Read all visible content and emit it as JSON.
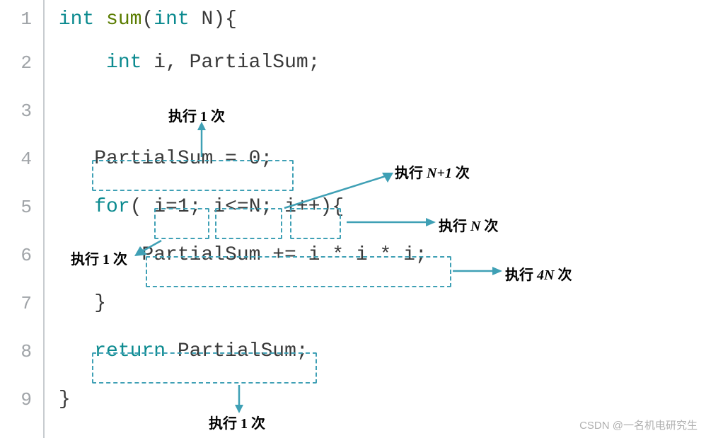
{
  "lines": {
    "l1_nums": [
      "1",
      "2",
      "3",
      "4",
      "5",
      "6",
      "7",
      "8",
      "9"
    ],
    "l1": {
      "kw1": "int",
      "fn": "sum",
      "kw2": "int",
      "arg": "N",
      "tail": "){"
    },
    "l2": {
      "kw": "int",
      "rest": " i, PartialSum;"
    },
    "l4": {
      "stmt": "PartialSum = 0;"
    },
    "l5": {
      "kw": "for",
      "p_init": "i=1;",
      "p_cond": "i<=N;",
      "p_inc": "i++",
      "tail": "){"
    },
    "l6": {
      "stmt": "PartialSum += i * i * i;"
    },
    "l7": {
      "brace": "}"
    },
    "l8": {
      "kw": "return",
      "rest": " PartialSum;"
    },
    "l9": {
      "brace": "}"
    }
  },
  "annotations": {
    "exec1a": "执行 1 次",
    "execNp1": {
      "pre": "执行 ",
      "it": "N+1",
      "post": " 次"
    },
    "execN": {
      "pre": "执行 ",
      "it": "N",
      "post": " 次"
    },
    "exec1b": "执行 1 次",
    "exec4N": {
      "pre": "执行 ",
      "it": "4N",
      "post": " 次"
    },
    "exec1c": "执行 1 次"
  },
  "watermark": "CSDN @一名机电研究生"
}
